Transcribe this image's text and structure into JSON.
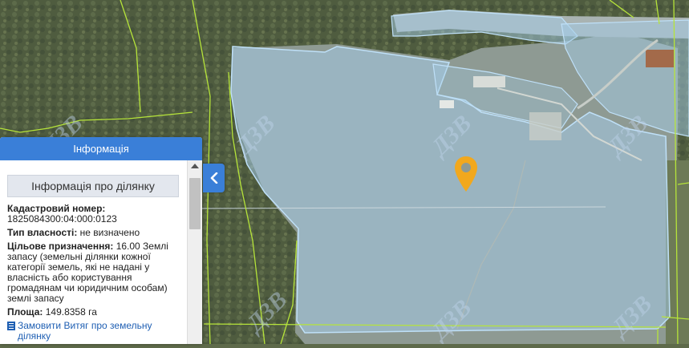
{
  "map": {
    "watermark_text": "ДЗВ",
    "colors": {
      "forest": "#4f5c3f",
      "field": "#93a0a3",
      "parcel_fill": "#9ec6e6",
      "parcel_border": "#a9d1f0",
      "boundary_green": "#b6e43a",
      "marker": "#f2a81d"
    }
  },
  "panel": {
    "header": "Інформація",
    "section_title": "Інформація про ділянку",
    "fields": [
      {
        "label": "Кадастровий номер:",
        "value": "1825084300:04:000:0123"
      },
      {
        "label": "Тип власності:",
        "value": "не визначено"
      },
      {
        "label": "Цільове призначення:",
        "value": "16.00 Землі запасу (земельні ділянки кожної категорії земель, які не надані у власність або користування громадянам чи юридичним особам) землі запасу"
      },
      {
        "label": "Площа:",
        "value": "149.8358 га"
      }
    ],
    "order_link": "Замовити Витяг про земельну ділянку"
  },
  "icons": {
    "collapse": "chevron-left-icon",
    "marker": "map-pin-icon",
    "document": "document-icon",
    "scroll_up": "arrow-up-icon"
  }
}
